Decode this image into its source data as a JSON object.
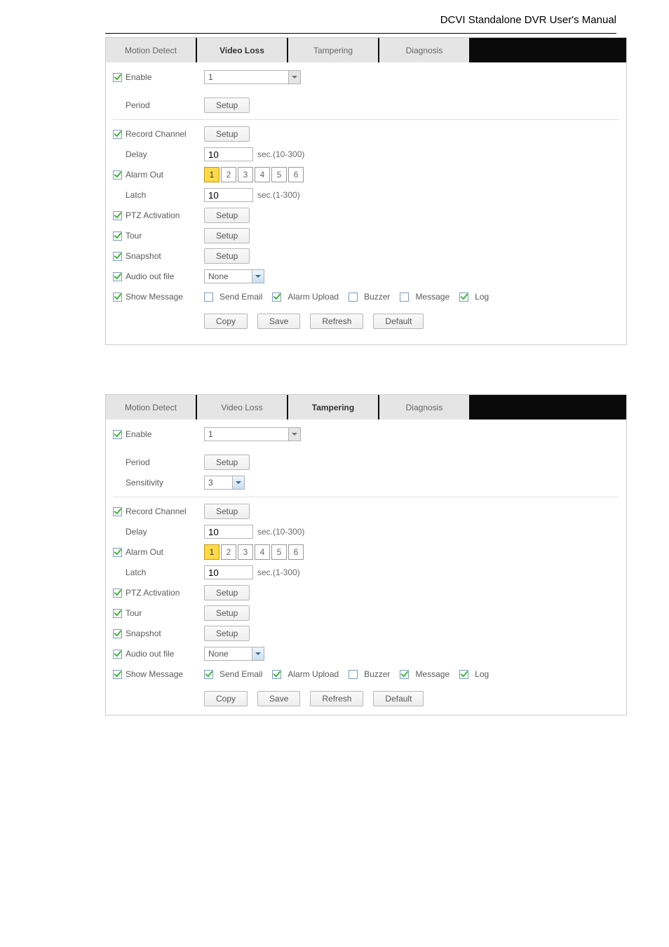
{
  "header": "DCVI Standalone DVR User's Manual",
  "tabs": {
    "motion": "Motion Detect",
    "videoLoss": "Video Loss",
    "tampering": "Tampering",
    "diagnosis": "Diagnosis"
  },
  "labels": {
    "enable": "Enable",
    "period": "Period",
    "sensitivity": "Sensitivity",
    "recordChannel": "Record Channel",
    "delay": "Delay",
    "alarmOut": "Alarm Out",
    "latch": "Latch",
    "ptz": "PTZ Activation",
    "tour": "Tour",
    "snapshot": "Snapshot",
    "audioOut": "Audio out file",
    "showMessage": "Show Message",
    "sendEmail": "Send Email",
    "alarmUpload": "Alarm Upload",
    "buzzer": "Buzzer",
    "message": "Message",
    "log": "Log",
    "setup": "Setup",
    "copy": "Copy",
    "save": "Save",
    "refresh": "Refresh",
    "default": "Default"
  },
  "values": {
    "channel": "1",
    "delay": "10",
    "delayHint": "sec.(10-300)",
    "latch": "10",
    "latchHint": "sec.(1-300)",
    "audioOut": "None",
    "sensitivity": "3",
    "alarmOutButtons": [
      "1",
      "2",
      "3",
      "4",
      "5",
      "6"
    ]
  }
}
